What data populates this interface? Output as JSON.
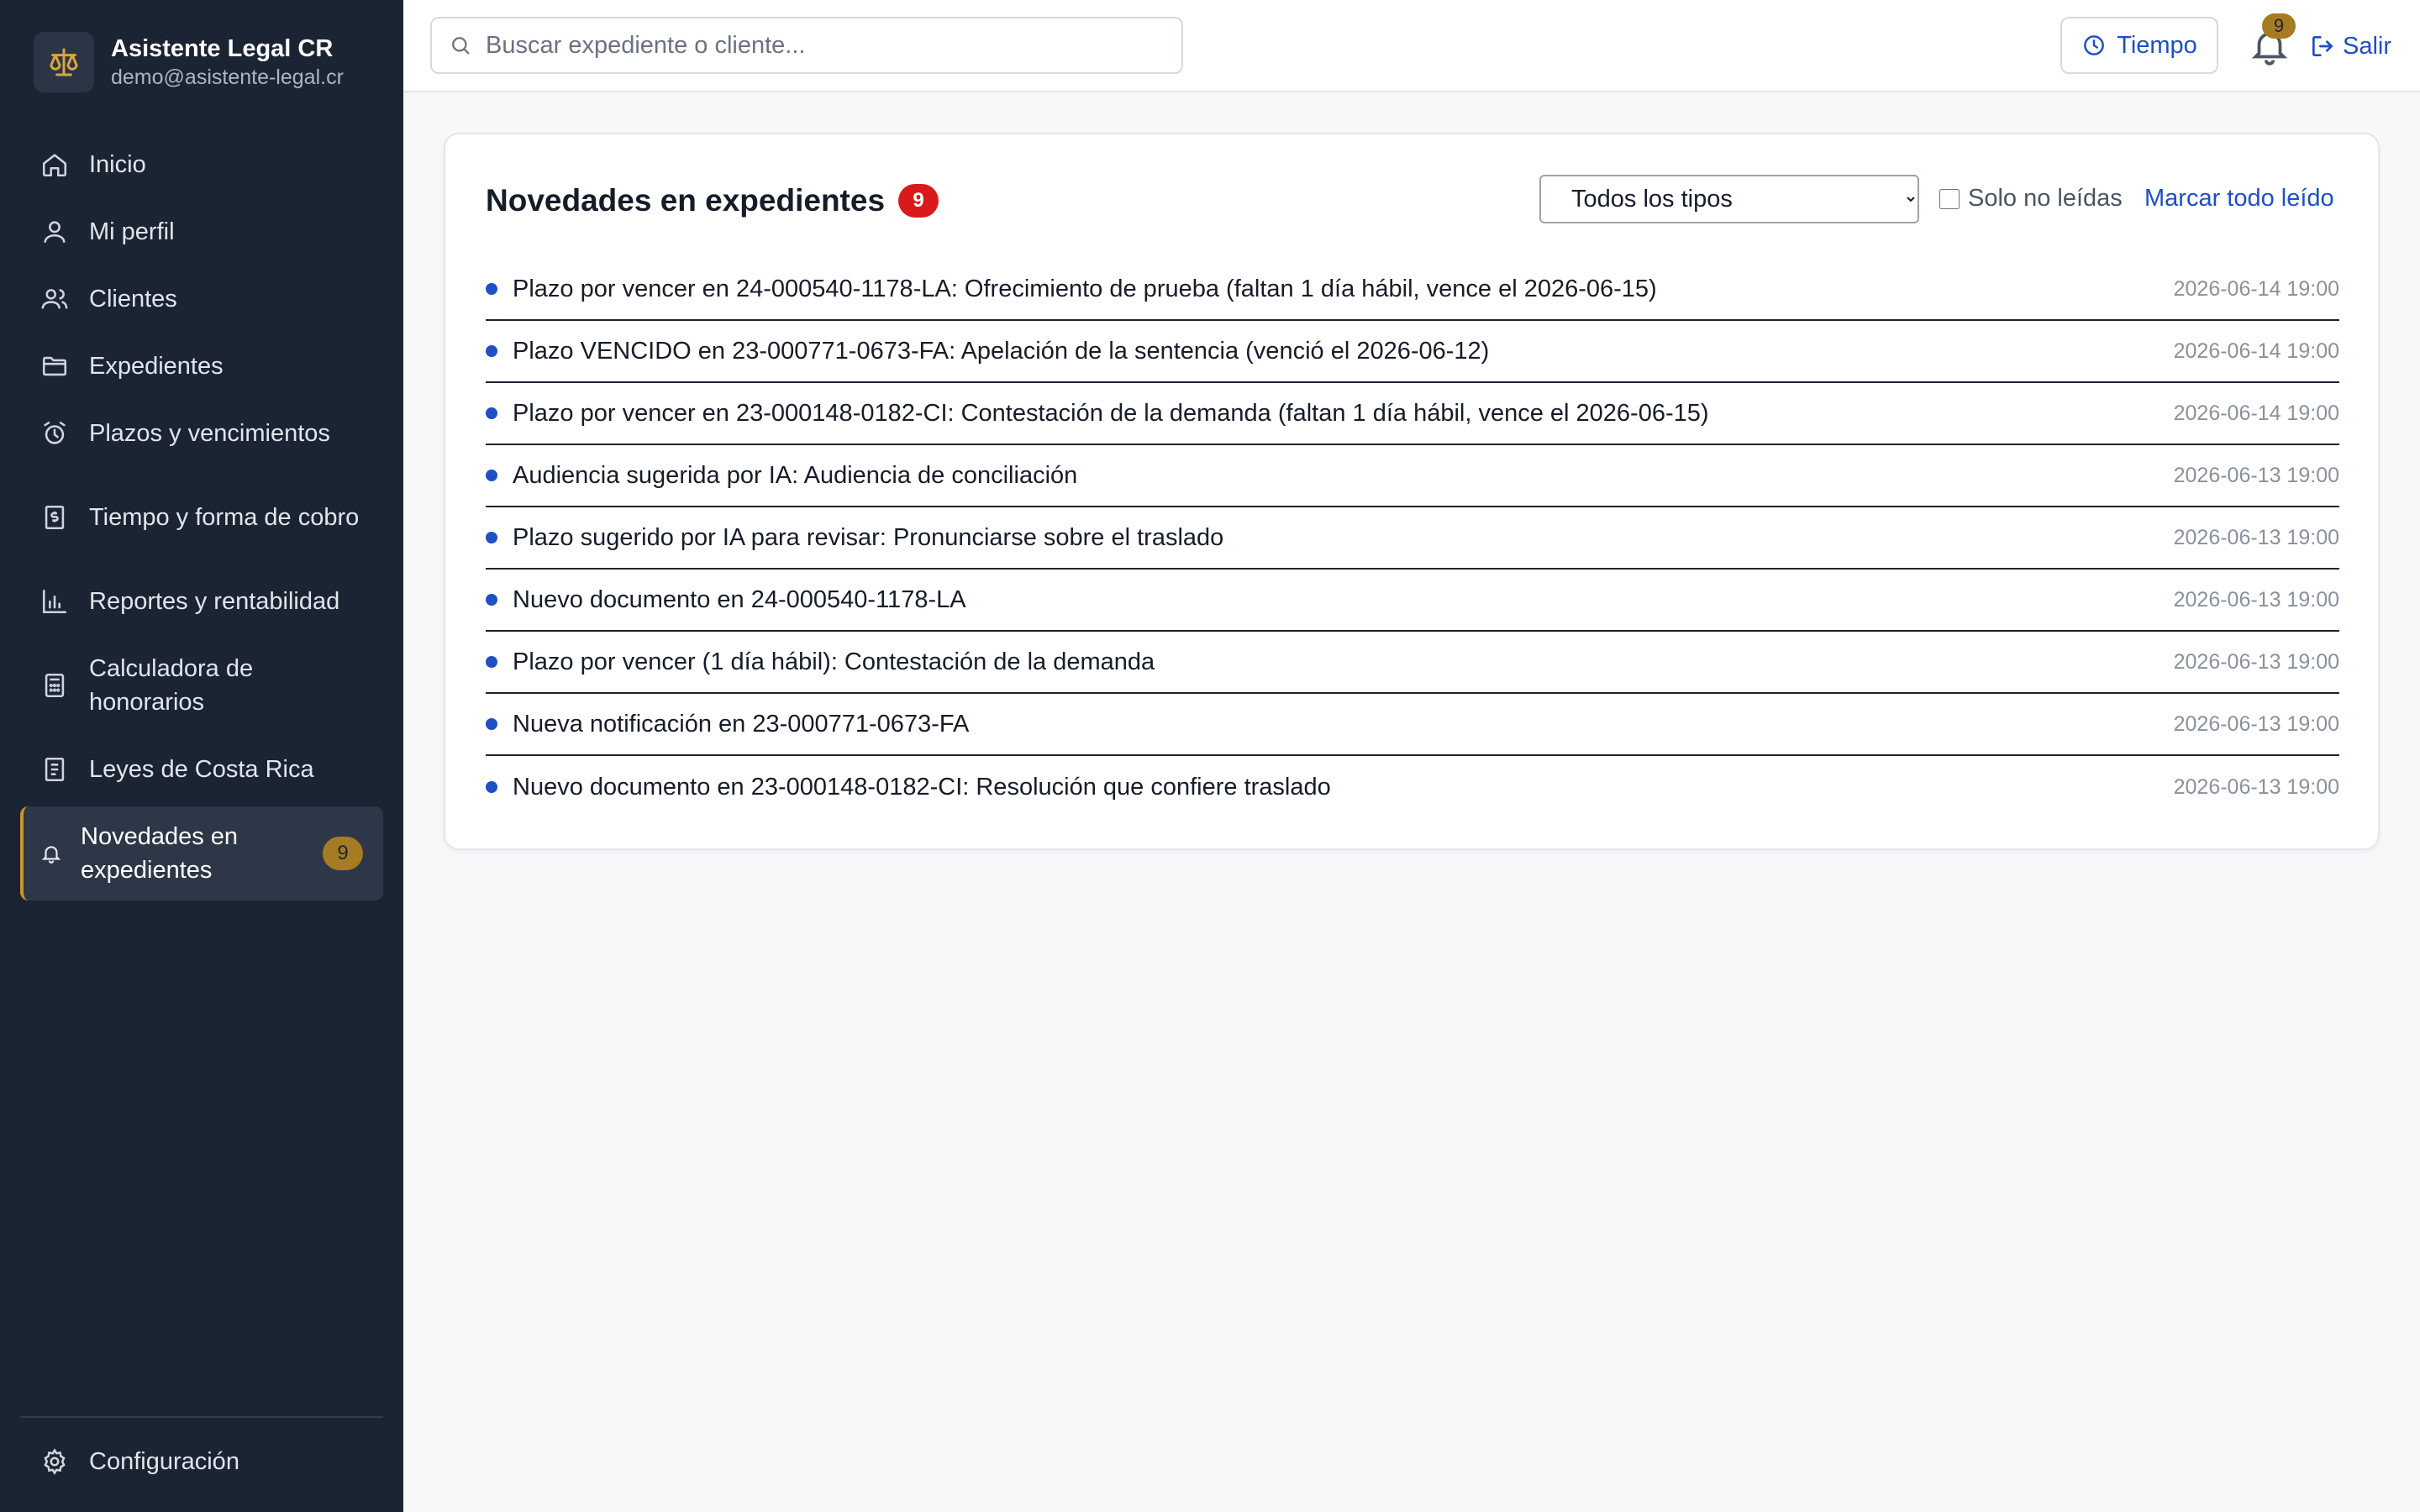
{
  "brand": {
    "title": "Asistente Legal CR",
    "email": "demo@asistente-legal.cr",
    "icon": "scale-icon"
  },
  "sidebar": {
    "items": [
      {
        "label": "Inicio",
        "icon": "home-icon"
      },
      {
        "label": "Mi perfil",
        "icon": "user-icon"
      },
      {
        "label": "Clientes",
        "icon": "users-icon"
      },
      {
        "label": "Expedientes",
        "icon": "folder-icon"
      },
      {
        "label": "Plazos y vencimientos",
        "icon": "alarm-clock-icon"
      },
      {
        "label": "Tiempo y forma de cobro",
        "icon": "billing-icon"
      },
      {
        "label": "Reportes y rentabilidad",
        "icon": "bar-chart-icon"
      },
      {
        "label": "Calculadora de honorarios",
        "icon": "calculator-icon"
      },
      {
        "label": "Leyes de Costa Rica",
        "icon": "book-icon"
      },
      {
        "label": "Novedades en expedientes",
        "icon": "bell-icon",
        "badge": "9",
        "active": true
      }
    ],
    "settings_label": "Configuración"
  },
  "topbar": {
    "search_placeholder": "Buscar expediente o cliente...",
    "tiempo_label": "Tiempo",
    "notifications_count": "9",
    "logout_label": "Salir"
  },
  "news": {
    "title": "Novedades en expedientes",
    "count": "9",
    "filter": {
      "selected": "Todos los tipos",
      "options": [
        "Todos los tipos"
      ]
    },
    "unread_only_label": "Solo no leídas",
    "unread_only_checked": false,
    "mark_all_label": "Marcar todo leído",
    "items": [
      {
        "text": "Plazo por vencer en 24-000540-1178-LA: Ofrecimiento de prueba (faltan 1 día hábil, vence el 2026-06-15)",
        "date": "2026-06-14 19:00"
      },
      {
        "text": "Plazo VENCIDO en 23-000771-0673-FA: Apelación de la sentencia (venció el 2026-06-12)",
        "date": "2026-06-14 19:00"
      },
      {
        "text": "Plazo por vencer en 23-000148-0182-CI: Contestación de la demanda (faltan 1 día hábil, vence el 2026-06-15)",
        "date": "2026-06-14 19:00"
      },
      {
        "text": "Audiencia sugerida por IA: Audiencia de conciliación",
        "date": "2026-06-13 19:00"
      },
      {
        "text": "Plazo sugerido por IA para revisar: Pronunciarse sobre el traslado",
        "date": "2026-06-13 19:00"
      },
      {
        "text": "Nuevo documento en 24-000540-1178-LA",
        "date": "2026-06-13 19:00"
      },
      {
        "text": "Plazo por vencer (1 día hábil): Contestación de la demanda",
        "date": "2026-06-13 19:00"
      },
      {
        "text": "Nueva notificación en 23-000771-0673-FA",
        "date": "2026-06-13 19:00"
      },
      {
        "text": "Nuevo documento en 23-000148-0182-CI: Resolución que confiere traslado",
        "date": "2026-06-13 19:00"
      }
    ]
  },
  "colors": {
    "sidebar_bg": "#1b2433",
    "accent_gold": "#a67c22",
    "link_blue": "#1e4fc4",
    "count_red": "#d91a1a"
  }
}
